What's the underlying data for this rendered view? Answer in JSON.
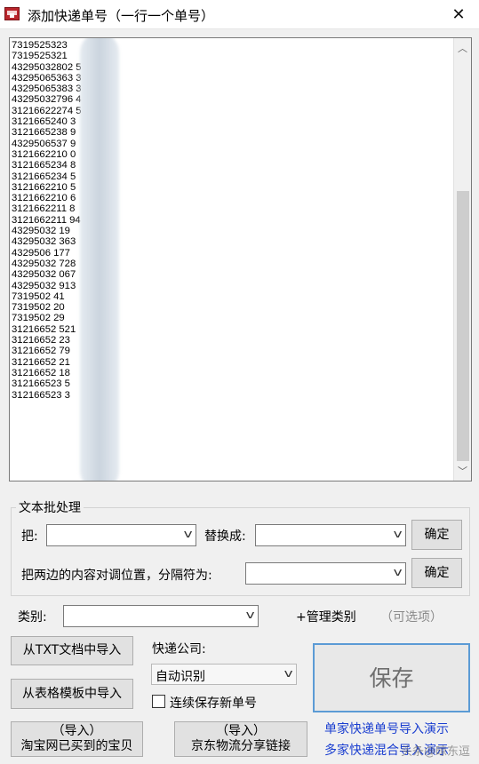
{
  "window": {
    "title": "添加快递单号（一行一个单号）",
    "close_symbol": "✕"
  },
  "tracking_numbers": [
    "7319525323",
    "7319525321",
    "43295032802 5",
    "43295065363 3",
    "43295065383 3",
    "43295032796 4",
    "31216622274 5",
    "3121665240 3",
    "3121665238 9",
    "4329506537 9",
    "3121662210 0",
    "3121665234 8",
    "3121665234 5",
    "3121662210 5",
    "3121662210 6",
    "3121662211 8",
    "3121662211 94",
    "43295032 19",
    "43295032 363",
    "4329506 177",
    "43295032 728",
    "43295032 067",
    "43295032 913",
    "7319502 41",
    "7319502 20",
    "7319502 29",
    "31216652 521",
    "31216652 23",
    "31216652 79",
    "31216652 21",
    "31216652 18",
    "312166523 5",
    "312166523 3"
  ],
  "batch": {
    "legend": "文本批处理",
    "replace_label": "把:",
    "replace_with_label": "替换成:",
    "confirm_label": "确定",
    "swap_label": "把两边的内容对调位置，分隔符为:",
    "confirm2_label": "确定"
  },
  "category": {
    "label": "类别:",
    "manage_label": "+管理类别",
    "optional_hint": "（可选项）"
  },
  "buttons": {
    "import_txt": "从TXT文档中导入",
    "import_excel": "从表格模板中导入",
    "import_taobao_line1": "（导入）",
    "import_taobao_line2": "淘宝网已买到的宝贝",
    "import_jd_line1": "（导入）",
    "import_jd_line2": "京东物流分享链接",
    "save": "保存"
  },
  "courier": {
    "label": "快递公司:",
    "selected": "自动识别"
  },
  "continuous_save": {
    "label": "连续保存新单号",
    "checked": false
  },
  "links": {
    "single_demo": "单家快递单号导入演示",
    "multi_demo": "多家快递混合导入演示"
  },
  "watermark": "头条@晾东逗"
}
